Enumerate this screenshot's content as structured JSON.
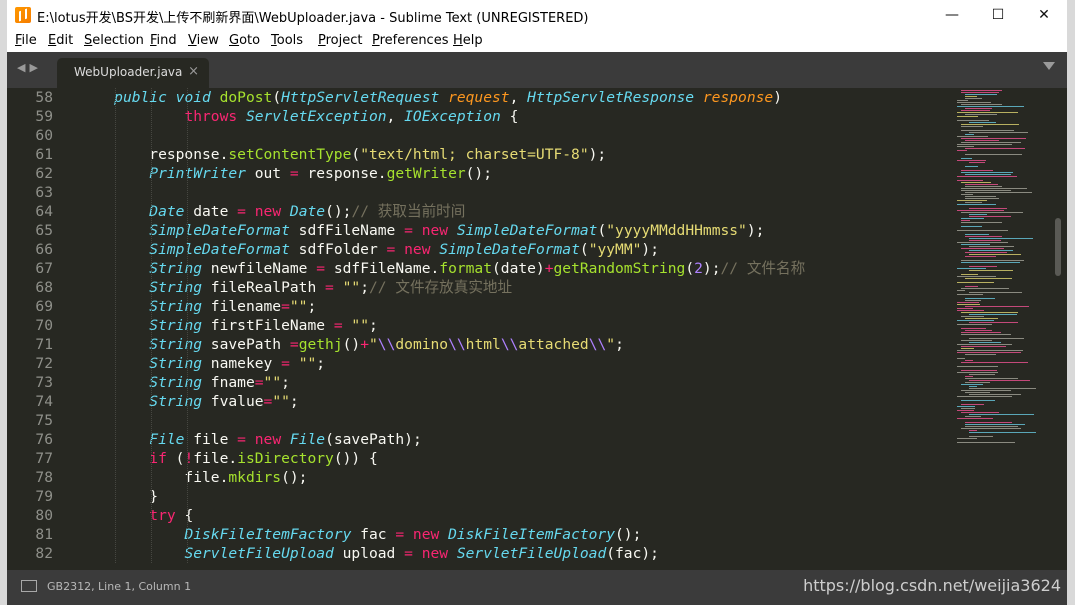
{
  "window": {
    "title": "E:\\lotus开发\\BS开发\\上传不刷新界面\\WebUploader.java - Sublime Text (UNREGISTERED)",
    "minimize_glyph": "—",
    "maximize_glyph": "☐",
    "close_glyph": "✕"
  },
  "menu": [
    "File",
    "Edit",
    "Selection",
    "Find",
    "View",
    "Goto",
    "Tools",
    "Project",
    "Preferences",
    "Help"
  ],
  "tab": {
    "label": "WebUploader.java",
    "close_glyph": "×",
    "nav_arrows": "◀▶"
  },
  "editor": {
    "line_numbers": [
      "58",
      "59",
      "60",
      "61",
      "62",
      "63",
      "64",
      "65",
      "66",
      "67",
      "68",
      "69",
      "70",
      "71",
      "72",
      "73",
      "74",
      "75",
      "76",
      "77",
      "78",
      "79",
      "80",
      "81",
      "82"
    ],
    "theme_colors": {
      "background": "#272822",
      "keyword": "#f92672",
      "type": "#66d9ef",
      "function": "#a6e22e",
      "parameter": "#fd971f",
      "string": "#e6db74",
      "comment": "#75715e",
      "escape": "#ae81ff"
    },
    "code_lines": [
      [
        [
          "",
          "    "
        ],
        [
          "kw",
          ""
        ],
        [
          "st",
          "public "
        ],
        [
          "st",
          "void "
        ],
        [
          "fn",
          "doPost"
        ],
        [
          "",
          "("
        ],
        [
          "ty",
          "HttpServletRequest "
        ],
        [
          "pa",
          "request"
        ],
        [
          "",
          ", "
        ],
        [
          "ty",
          "HttpServletResponse "
        ],
        [
          "pa",
          "response"
        ],
        [
          "",
          ")"
        ]
      ],
      [
        [
          "",
          "            "
        ],
        [
          "kw",
          "throws "
        ],
        [
          "ty",
          "ServletException"
        ],
        [
          "",
          ", "
        ],
        [
          "ty",
          "IOException"
        ],
        [
          "",
          " {"
        ]
      ],
      [],
      [
        [
          "",
          "        response."
        ],
        [
          "fn",
          "setContentType"
        ],
        [
          "",
          "("
        ],
        [
          "str",
          "\"text/html; charset=UTF-8\""
        ],
        [
          "",
          ");"
        ]
      ],
      [
        [
          "",
          "        "
        ],
        [
          "ty",
          "PrintWriter"
        ],
        [
          "",
          " out "
        ],
        [
          "kw",
          "="
        ],
        [
          "",
          " response."
        ],
        [
          "fn",
          "getWriter"
        ],
        [
          "",
          "();"
        ]
      ],
      [],
      [
        [
          "",
          "        "
        ],
        [
          "ty",
          "Date"
        ],
        [
          "",
          " date "
        ],
        [
          "kw",
          "="
        ],
        [
          "",
          " "
        ],
        [
          "kw",
          "new "
        ],
        [
          "ty",
          "Date"
        ],
        [
          "",
          "();"
        ],
        [
          "cm",
          "// 获取当前时间"
        ]
      ],
      [
        [
          "",
          "        "
        ],
        [
          "ty",
          "SimpleDateFormat"
        ],
        [
          "",
          " sdfFileName "
        ],
        [
          "kw",
          "="
        ],
        [
          "",
          " "
        ],
        [
          "kw",
          "new "
        ],
        [
          "ty",
          "SimpleDateFormat"
        ],
        [
          "",
          "("
        ],
        [
          "str",
          "\"yyyyMMddHHmmss\""
        ],
        [
          "",
          ");"
        ]
      ],
      [
        [
          "",
          "        "
        ],
        [
          "ty",
          "SimpleDateFormat"
        ],
        [
          "",
          " sdfFolder "
        ],
        [
          "kw",
          "="
        ],
        [
          "",
          " "
        ],
        [
          "kw",
          "new "
        ],
        [
          "ty",
          "SimpleDateFormat"
        ],
        [
          "",
          "("
        ],
        [
          "str",
          "\"yyMM\""
        ],
        [
          "",
          ");"
        ]
      ],
      [
        [
          "",
          "        "
        ],
        [
          "ty",
          "String"
        ],
        [
          "",
          " newfileName "
        ],
        [
          "kw",
          "="
        ],
        [
          "",
          " sdfFileName."
        ],
        [
          "fn",
          "format"
        ],
        [
          "",
          "(date)"
        ],
        [
          "kw",
          "+"
        ],
        [
          "fn",
          "getRandomString"
        ],
        [
          "",
          "("
        ],
        [
          "esc",
          "2"
        ],
        [
          "",
          ");"
        ],
        [
          "cm",
          "// 文件名称"
        ]
      ],
      [
        [
          "",
          "        "
        ],
        [
          "ty",
          "String"
        ],
        [
          "",
          " fileRealPath "
        ],
        [
          "kw",
          "="
        ],
        [
          "",
          " "
        ],
        [
          "str",
          "\"\""
        ],
        [
          "",
          ";"
        ],
        [
          "cm",
          "// 文件存放真实地址"
        ]
      ],
      [
        [
          "",
          "        "
        ],
        [
          "ty",
          "String"
        ],
        [
          "",
          " filename"
        ],
        [
          "kw",
          "="
        ],
        [
          "str",
          "\"\""
        ],
        [
          "",
          ";"
        ]
      ],
      [
        [
          "",
          "        "
        ],
        [
          "ty",
          "String"
        ],
        [
          "",
          " firstFileName "
        ],
        [
          "kw",
          "="
        ],
        [
          "",
          " "
        ],
        [
          "str",
          "\"\""
        ],
        [
          "",
          ";"
        ]
      ],
      [
        [
          "",
          "        "
        ],
        [
          "ty",
          "String"
        ],
        [
          "",
          " savePath "
        ],
        [
          "kw",
          "="
        ],
        [
          "fn",
          "gethj"
        ],
        [
          "",
          "()"
        ],
        [
          "kw",
          "+"
        ],
        [
          "str",
          "\""
        ],
        [
          "esc",
          "\\\\"
        ],
        [
          "str",
          "domino"
        ],
        [
          "esc",
          "\\\\"
        ],
        [
          "str",
          "html"
        ],
        [
          "esc",
          "\\\\"
        ],
        [
          "str",
          "attached"
        ],
        [
          "esc",
          "\\\\"
        ],
        [
          "str",
          "\""
        ],
        [
          "",
          ";"
        ]
      ],
      [
        [
          "",
          "        "
        ],
        [
          "ty",
          "String"
        ],
        [
          "",
          " namekey "
        ],
        [
          "kw",
          "="
        ],
        [
          "",
          " "
        ],
        [
          "str",
          "\"\""
        ],
        [
          "",
          ";"
        ]
      ],
      [
        [
          "",
          "        "
        ],
        [
          "ty",
          "String"
        ],
        [
          "",
          " fname"
        ],
        [
          "kw",
          "="
        ],
        [
          "str",
          "\"\""
        ],
        [
          "",
          ";"
        ]
      ],
      [
        [
          "",
          "        "
        ],
        [
          "ty",
          "String"
        ],
        [
          "",
          " fvalue"
        ],
        [
          "kw",
          "="
        ],
        [
          "str",
          "\"\""
        ],
        [
          "",
          ";"
        ]
      ],
      [],
      [
        [
          "",
          "        "
        ],
        [
          "ty",
          "File"
        ],
        [
          "",
          " file "
        ],
        [
          "kw",
          "="
        ],
        [
          "",
          " "
        ],
        [
          "kw",
          "new "
        ],
        [
          "ty",
          "File"
        ],
        [
          "",
          "(savePath);"
        ]
      ],
      [
        [
          "",
          "        "
        ],
        [
          "kw",
          "if"
        ],
        [
          "",
          " ("
        ],
        [
          "kw",
          "!"
        ],
        [
          "",
          "file."
        ],
        [
          "fn",
          "isDirectory"
        ],
        [
          "",
          "()) {"
        ]
      ],
      [
        [
          "",
          "            file."
        ],
        [
          "fn",
          "mkdirs"
        ],
        [
          "",
          "();"
        ]
      ],
      [
        [
          "",
          "        }"
        ]
      ],
      [
        [
          "",
          "        "
        ],
        [
          "kw",
          "try"
        ],
        [
          "",
          " {"
        ]
      ],
      [
        [
          "",
          "            "
        ],
        [
          "ty",
          "DiskFileItemFactory"
        ],
        [
          "",
          " fac "
        ],
        [
          "kw",
          "="
        ],
        [
          "",
          " "
        ],
        [
          "kw",
          "new "
        ],
        [
          "ty",
          "DiskFileItemFactory"
        ],
        [
          "",
          "();"
        ]
      ],
      [
        [
          "",
          "            "
        ],
        [
          "ty",
          "ServletFileUpload"
        ],
        [
          "",
          " upload "
        ],
        [
          "kw",
          "="
        ],
        [
          "",
          " "
        ],
        [
          "kw",
          "new "
        ],
        [
          "ty",
          "ServletFileUpload"
        ],
        [
          "",
          "(fac);"
        ]
      ]
    ]
  },
  "status": {
    "text": "GB2312, Line 1, Column 1"
  },
  "watermark": "https://blog.csdn.net/weijia3624"
}
